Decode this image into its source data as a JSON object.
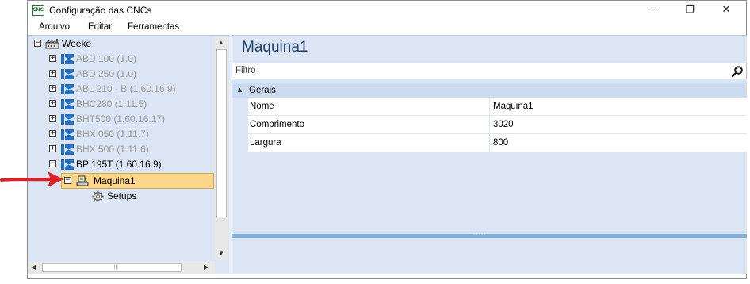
{
  "window": {
    "title": "Configuração das CNCs",
    "app_icon_text": "CNC",
    "minimize_glyph": "—",
    "maximize_glyph": "❐",
    "close_glyph": "✕"
  },
  "menu": [
    "Arquivo",
    "Editar",
    "Ferramentas"
  ],
  "tree": {
    "root": {
      "label": "Weeke",
      "expander": "⊟"
    },
    "machines": [
      {
        "label": "ABD 100 (1.0)",
        "expander": "+",
        "enabled": false
      },
      {
        "label": "ABD 250 (1.0)",
        "expander": "+",
        "enabled": false
      },
      {
        "label": "ABL 210 - B (1.60.16.9)",
        "expander": "+",
        "enabled": false
      },
      {
        "label": "BHC280 (1.11.5)",
        "expander": "+",
        "enabled": false
      },
      {
        "label": "BHT500 (1.60.16.17)",
        "expander": "+",
        "enabled": false
      },
      {
        "label": "BHX 050 (1.11.7)",
        "expander": "+",
        "enabled": false
      },
      {
        "label": "BHX 500 (1.11.6)",
        "expander": "+",
        "enabled": false
      },
      {
        "label": "BP 195T (1.60.16.9)",
        "expander": "−",
        "enabled": true
      }
    ],
    "selected": {
      "label": "Maquina1",
      "expander": "−"
    },
    "child": {
      "label": "Setups"
    }
  },
  "detail": {
    "title": "Maquina1",
    "filter_placeholder": "Filtro",
    "group": {
      "label": "Gerais",
      "toggle": "▲"
    },
    "properties": [
      {
        "name": "Nome",
        "value": "Maquina1"
      },
      {
        "name": "Comprimento",
        "value": "3020"
      },
      {
        "name": "Largura",
        "value": "800"
      }
    ]
  },
  "colors": {
    "accent": "#1f3f6e",
    "selection": "#fcd68a",
    "annotation_arrow": "#e02020",
    "pane_background": "#dbe5f3"
  }
}
